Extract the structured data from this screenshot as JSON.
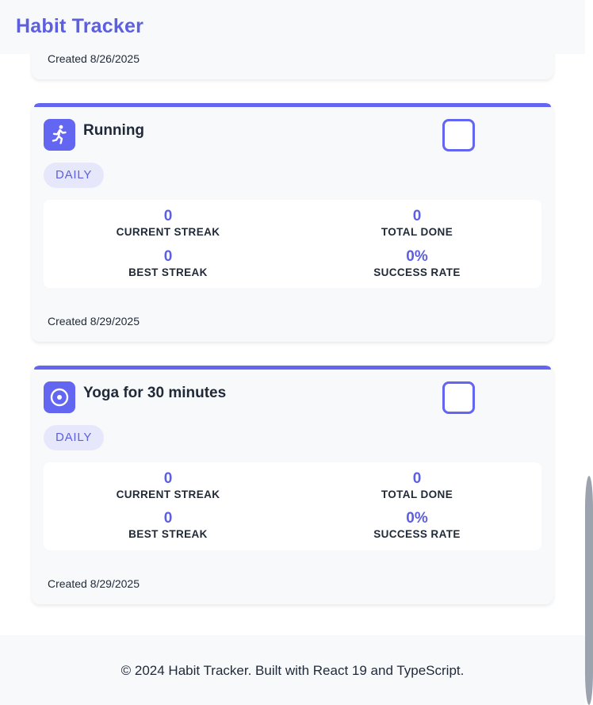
{
  "header": {
    "title": "Habit Tracker"
  },
  "cards": [
    {
      "created": "Created 8/26/2025"
    },
    {
      "title": "Running",
      "icon": "running-person-icon",
      "frequency": "DAILY",
      "stats": {
        "current_streak": {
          "value": "0",
          "label": "CURRENT STREAK"
        },
        "total_done": {
          "value": "0",
          "label": "TOTAL DONE"
        },
        "best_streak": {
          "value": "0",
          "label": "BEST STREAK"
        },
        "success_rate": {
          "value": "0%",
          "label": "SUCCESS RATE"
        }
      },
      "created": "Created 8/29/2025",
      "completed": false
    },
    {
      "title": "Yoga for 30 minutes",
      "icon": "target-circle-icon",
      "frequency": "DAILY",
      "stats": {
        "current_streak": {
          "value": "0",
          "label": "CURRENT STREAK"
        },
        "total_done": {
          "value": "0",
          "label": "TOTAL DONE"
        },
        "best_streak": {
          "value": "0",
          "label": "BEST STREAK"
        },
        "success_rate": {
          "value": "0%",
          "label": "SUCCESS RATE"
        }
      },
      "created": "Created 8/29/2025",
      "completed": false
    }
  ],
  "footer": {
    "text": "© 2024 Habit Tracker. Built with React 19 and TypeScript."
  },
  "colors": {
    "accent": "#6366f1",
    "background": "#f8f9fb",
    "badge_bg": "#e6e7fb"
  }
}
